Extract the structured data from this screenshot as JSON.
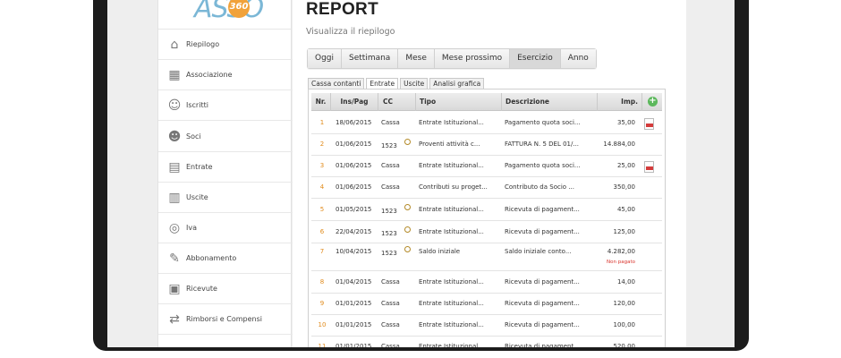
{
  "page": {
    "title": "REPORT",
    "subtitle": "Visualizza il riepilogo"
  },
  "sidebar": {
    "items": [
      {
        "label": "Riepilogo",
        "icon": "home-icon"
      },
      {
        "label": "Associazione",
        "icon": "building-icon"
      },
      {
        "label": "Iscritti",
        "icon": "person-icon"
      },
      {
        "label": "Soci",
        "icon": "person-group-icon"
      },
      {
        "label": "Entrate",
        "icon": "document-in-icon"
      },
      {
        "label": "Uscite",
        "icon": "document-out-icon"
      },
      {
        "label": "Iva",
        "icon": "coin-icon"
      },
      {
        "label": "Abbonamento",
        "icon": "pen-paper-icon"
      },
      {
        "label": "Ricevute",
        "icon": "receipt-icon"
      },
      {
        "label": "Rimborsi e Compensi",
        "icon": "refund-icon"
      }
    ]
  },
  "range_tabs": [
    "Oggi",
    "Settimana",
    "Mese",
    "Mese prossimo",
    "Esercizio",
    "Anno"
  ],
  "range_active": "Esercizio",
  "sub_tabs": [
    "Cassa contanti",
    "Entrate",
    "Uscite",
    "Analisi grafica"
  ],
  "sub_active": "Entrate",
  "table": {
    "headers": {
      "nr": "Nr.",
      "date": "Ins/Pag",
      "cc": "CC",
      "tipo": "Tipo",
      "desc": "Descrizione",
      "imp": "Imp."
    },
    "rows": [
      {
        "nr": "1",
        "date": "18/06/2015",
        "cc": "Cassa",
        "tipo": "Entrate Istituzional...",
        "desc": "Pagamento quota soci...",
        "imp": "35,00",
        "pdf": true
      },
      {
        "nr": "2",
        "date": "01/06/2015",
        "cc": "1523",
        "lens": true,
        "tipo": "Proventi attività  c...",
        "desc": "FATTURA N. 5 DEL 01/...",
        "imp": "14.884,00"
      },
      {
        "nr": "3",
        "date": "01/06/2015",
        "cc": "Cassa",
        "tipo": "Entrate Istituzional...",
        "desc": "Pagamento quota soci...",
        "imp": "25,00",
        "pdf": true
      },
      {
        "nr": "4",
        "date": "01/06/2015",
        "cc": "Cassa",
        "tipo": "Contributi su proget...",
        "desc": "Contributo da Socio ...",
        "imp": "350,00"
      },
      {
        "nr": "5",
        "date": "01/05/2015",
        "cc": "1523",
        "lens": true,
        "tipo": "Entrate Istituzional...",
        "desc": "Ricevuta di pagament...",
        "imp": "45,00"
      },
      {
        "nr": "6",
        "date": "22/04/2015",
        "cc": "1523",
        "lens": true,
        "tipo": "Entrate Istituzional...",
        "desc": "Ricevuta di pagament...",
        "imp": "125,00"
      },
      {
        "nr": "7",
        "date": "10/04/2015",
        "cc": "1523",
        "lens": true,
        "tipo": "Saldo iniziale",
        "desc": "Saldo iniziale conto...",
        "imp": "4.282,00",
        "note": "Non pagato"
      },
      {
        "nr": "8",
        "date": "01/04/2015",
        "cc": "Cassa",
        "tipo": "Entrate Istituzional...",
        "desc": "Ricevuta di pagament...",
        "imp": "14,00"
      },
      {
        "nr": "9",
        "date": "01/01/2015",
        "cc": "Cassa",
        "tipo": "Entrate Istituzional...",
        "desc": "Ricevuta di pagament...",
        "imp": "120,00"
      },
      {
        "nr": "10",
        "date": "01/01/2015",
        "cc": "Cassa",
        "tipo": "Entrate Istituzional...",
        "desc": "Ricevuta di pagament...",
        "imp": "100,00"
      },
      {
        "nr": "11",
        "date": "01/01/2015",
        "cc": "Cassa",
        "tipo": "Entrate Istituzional...",
        "desc": "Ricevuta di pagament...",
        "imp": "520,00"
      }
    ]
  },
  "colors": {
    "accent": "#e08a1a",
    "add": "#5cb85c",
    "note": "#d9332b",
    "logo": "#7bb7d6",
    "logo_badge": "#f1a23a"
  }
}
